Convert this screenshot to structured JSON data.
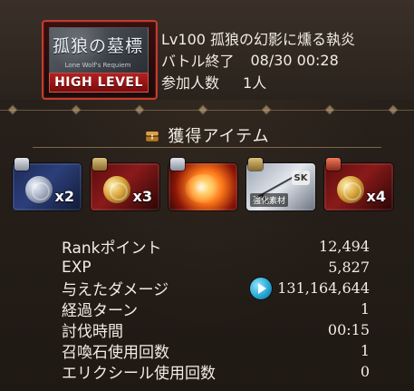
{
  "banner": {
    "title": "孤狼の墓標",
    "subtitle": "Lone Wolf's Requiem",
    "tag": "HIGH LEVEL"
  },
  "battle": {
    "quest_name": "Lv100 孤狼の幻影に燻る執炎",
    "status_label": "バトル終了",
    "end_time": "08/30 00:28",
    "participants_label": "参加人数",
    "participants_value": "1人"
  },
  "obtained_items": {
    "title": "獲得アイテム",
    "items": [
      {
        "chest": "silver",
        "name_icon": "silver-medal",
        "quantity": "x2"
      },
      {
        "chest": "gold",
        "name_icon": "gold-medal",
        "quantity": "x3"
      },
      {
        "chest": "silver",
        "name_icon": "fire-orb",
        "quantity": ""
      },
      {
        "chest": "gold",
        "name_icon": "weapon-sword",
        "badge": "SK",
        "label": "強化素材",
        "quantity": ""
      },
      {
        "chest": "red",
        "name_icon": "gold-medal",
        "quantity": "x4"
      }
    ]
  },
  "results": {
    "rows": [
      {
        "label": "Rankポイント",
        "value": "12,494"
      },
      {
        "label": "EXP",
        "value": "5,827"
      },
      {
        "label": "与えたダメージ",
        "value": "131,164,644"
      },
      {
        "label": "経過ターン",
        "value": "1"
      },
      {
        "label": "討伐時間",
        "value": "00:15"
      },
      {
        "label": "召喚石使用回数",
        "value": "1"
      },
      {
        "label": "エリクシール使用回数",
        "value": "0"
      }
    ]
  },
  "colors": {
    "accent_red": "#c53b2d",
    "text": "#f2ece2",
    "divider": "#dcbf8c"
  }
}
